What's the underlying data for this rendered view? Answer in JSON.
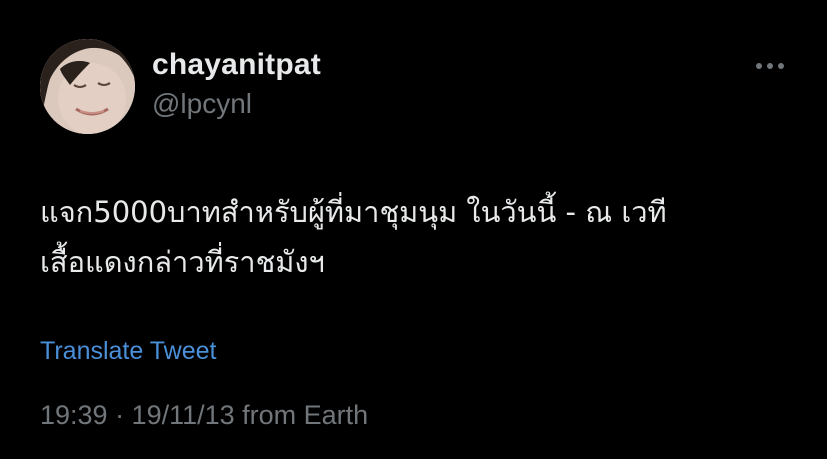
{
  "author": {
    "display_name": "chayanitpat",
    "handle": "@lpcynl",
    "avatar_icon": "user-avatar-photo"
  },
  "menu": {
    "icon": "more-horizontal-icon"
  },
  "tweet": {
    "text_line_1": "แจก5000บาทสำหรับผู้ที่มาชุมนุม ในวันนี้ - ณ เวที",
    "text_line_2": "เสื้อแดงกล่าวที่ราชมังฯ"
  },
  "translate": {
    "label": "Translate Tweet"
  },
  "meta": {
    "timestamp": "19:39 · 19/11/13 from Earth"
  },
  "colors": {
    "background": "#000000",
    "primary_text": "#e7e9ea",
    "secondary_text": "#71767b",
    "link": "#4a90d9"
  }
}
